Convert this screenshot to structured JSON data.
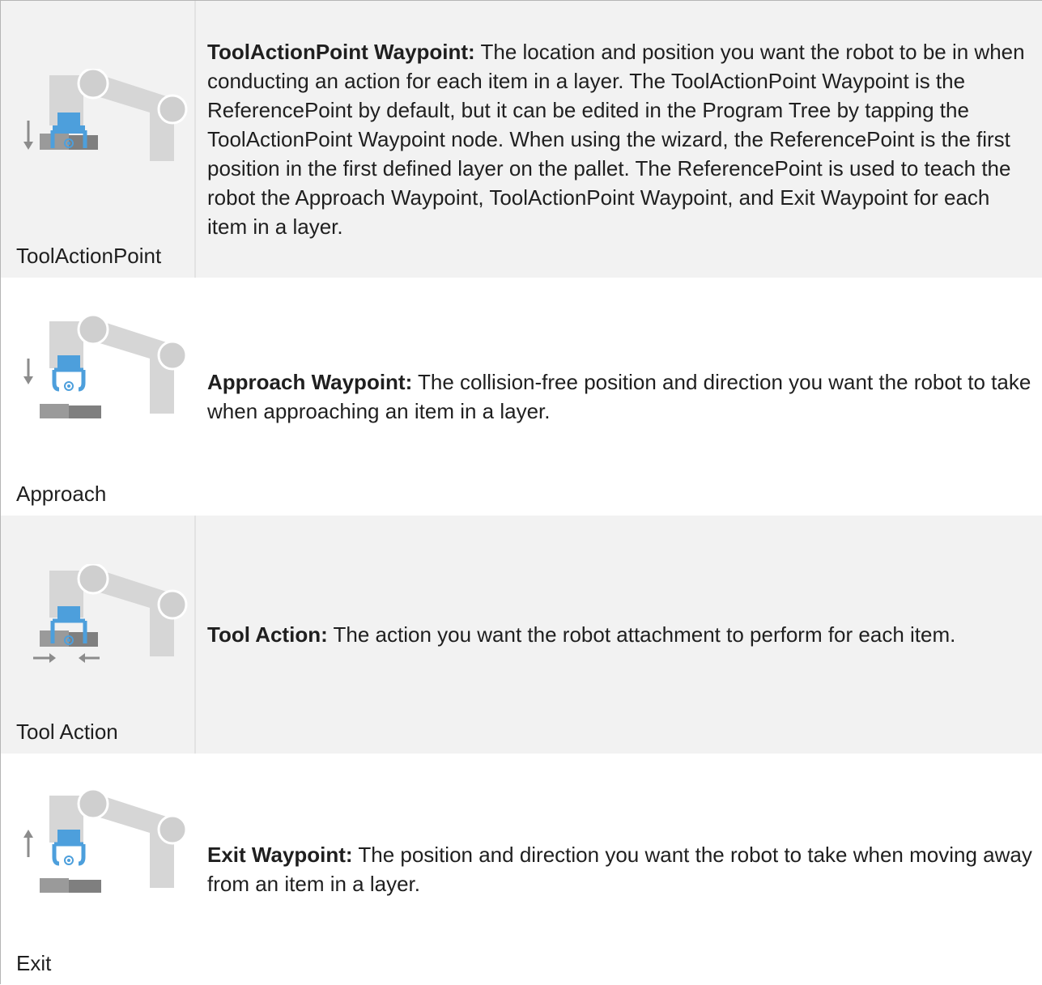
{
  "rows": [
    {
      "caption": "ToolActionPoint",
      "term": "ToolActionPoint Waypoint:",
      "description": " The location and position you want the robot to be in when conducting an action for each item in a layer. The ToolActionPoint Waypoint is the ReferencePoint by default, but it can be edited in the Program Tree by tapping the ToolActionPoint Waypoint node. When using the wizard, the ReferencePoint is the first position in the first defined layer on the pallet. The ReferencePoint is used to teach the robot the Approach Waypoint, ToolActionPoint Waypoint, and Exit Waypoint for each item in a layer.",
      "icon": "robot-arm-tool-action-point-icon"
    },
    {
      "caption": "Approach",
      "term": "Approach Waypoint:",
      "description": " The collision-free position and direction you want the robot to take when approaching an item in a layer.",
      "icon": "robot-arm-approach-icon"
    },
    {
      "caption": "Tool Action",
      "term": "Tool Action:",
      "description": " The action you want the robot attachment to perform for each item.",
      "icon": "robot-arm-tool-action-icon"
    },
    {
      "caption": "Exit",
      "term": "Exit Waypoint:",
      "description": " The position and direction you want the robot to take when moving away from an item in a layer.",
      "icon": "robot-arm-exit-icon"
    }
  ],
  "colors": {
    "arm_gray": "#d6d6d6",
    "arm_dark": "#c4c4c4",
    "gripper_blue": "#4d9fdc",
    "box_gray": "#8a8a8a",
    "arrow_gray": "#8c8c8c"
  }
}
